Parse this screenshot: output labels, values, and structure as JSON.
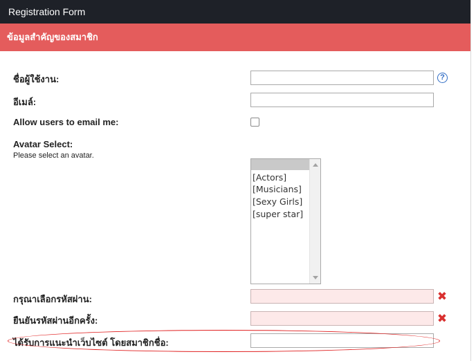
{
  "header": {
    "title": "Registration Form"
  },
  "section": {
    "title": "ข้อมูลสำคัญของสมาชิก"
  },
  "fields": {
    "username": {
      "label": "ชื่อผู้ใช้งาน:",
      "value": "",
      "help_icon": "question-circle-icon",
      "help_glyph": "?"
    },
    "email": {
      "label": "อีเมล์:",
      "value": ""
    },
    "allow_email": {
      "label": "Allow users to email me:",
      "checked": false
    },
    "avatar": {
      "label": "Avatar Select:",
      "hint": "Please select an avatar.",
      "options": [
        "[Actors]",
        "[Musicians]",
        "[Sexy Girls]",
        "[super star]"
      ]
    },
    "password": {
      "label": "กรุณาเลือกรหัสผ่าน:",
      "value": "",
      "error_icon": "red-x-icon",
      "error_glyph": "✖"
    },
    "password_confirm": {
      "label": "ยืนยันรหัสผ่านอีกครั้ง:",
      "value": "",
      "error_icon": "red-x-icon",
      "error_glyph": "✖"
    },
    "referrer": {
      "label": "ได้รับการแนะนำเว็บไซต์ โดยสมาชิกชื่อ:",
      "value": ""
    }
  },
  "colors": {
    "titlebar": "#1e2128",
    "section": "#e45c5c",
    "invalid_field": "#fde9e9",
    "error_icon": "#d9302f",
    "highlight_ring": "#e01e1e"
  }
}
